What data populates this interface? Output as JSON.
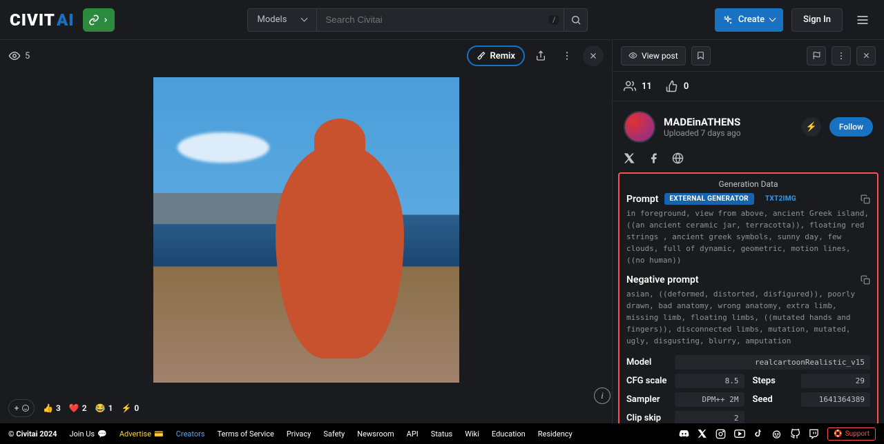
{
  "header": {
    "logo_left": "CIVIT",
    "logo_right": "AI",
    "models_label": "Models",
    "search_placeholder": "Search Civitai",
    "slash_hint": "/",
    "create_label": "Create",
    "signin_label": "Sign In"
  },
  "viewer": {
    "view_count": "5",
    "remix_label": "Remix"
  },
  "reactions": {
    "thumbs": "3",
    "heart": "2",
    "laugh": "1",
    "zap": "0"
  },
  "sidebar": {
    "viewpost": "View post",
    "people_count": "11",
    "like_count": "0",
    "username": "MADEinATHENS",
    "uploaded": "Uploaded 7 days ago",
    "follow": "Follow"
  },
  "gen": {
    "title": "Generation Data",
    "prompt_label": "Prompt",
    "badge_ext": "EXTERNAL GENERATOR",
    "badge_txt": "TXT2IMG",
    "prompt_text": "in foreground, view from above,  ancient Greek island, ((an ancient ceramic jar, terracotta)), floating red strings , ancient greek symbols, sunny day, few clouds, full of dynamic, geometric, motion lines, ((no human))",
    "neg_label": "Negative prompt",
    "neg_text": "asian, ((deformed, distorted, disfigured)), poorly drawn, bad anatomy, wrong anatomy, extra limb, missing limb, floating limbs, ((mutated hands and fingers)), disconnected limbs, mutation, mutated, ugly, disgusting, blurry, amputation",
    "params": {
      "model_label": "Model",
      "model_val": "realcartoonRealistic_v15",
      "cfg_label": "CFG scale",
      "cfg_val": "8.5",
      "steps_label": "Steps",
      "steps_val": "29",
      "sampler_label": "Sampler",
      "sampler_val": "DPM++ 2M",
      "seed_label": "Seed",
      "seed_val": "1641364389",
      "clip_label": "Clip skip",
      "clip_val": "2"
    }
  },
  "footer": {
    "copyright": "© Civitai 2024",
    "join": "Join Us",
    "advertise": "Advertise",
    "links": [
      "Creators",
      "Terms of Service",
      "Privacy",
      "Safety",
      "Newsroom",
      "API",
      "Status",
      "Wiki",
      "Education",
      "Residency"
    ],
    "support": "Support"
  }
}
